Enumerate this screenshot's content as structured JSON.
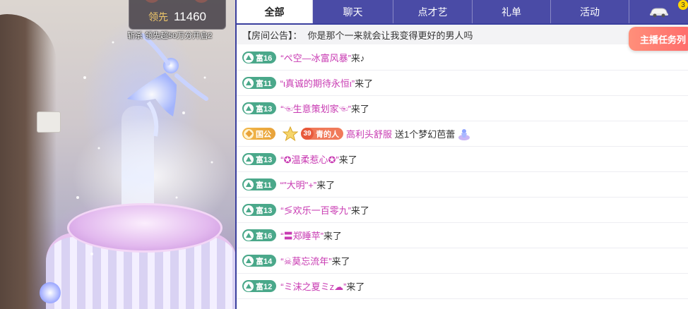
{
  "video": {
    "lead_label": "领先",
    "lead_value": "11460",
    "pk_tip": "斩杀  领先超50万分开启2"
  },
  "tabs": [
    {
      "label": "全部",
      "active": true
    },
    {
      "label": "聊天",
      "active": false
    },
    {
      "label": "点才艺",
      "active": false
    },
    {
      "label": "礼单",
      "active": false
    },
    {
      "label": "活动",
      "active": false
    },
    {
      "label": "",
      "icon": "car-icon",
      "badge": "3",
      "active": false
    }
  ],
  "notice": {
    "label": "【房间公告】：",
    "text": "你是那个一来就会让我变得更好的男人吗"
  },
  "task_button": "主播任务列",
  "messages": [
    {
      "type": "enter",
      "badge": "富16",
      "name": "“ぺ空—冰富风暴”",
      "suffix": "来♪"
    },
    {
      "type": "enter",
      "badge": "富11",
      "name": "“ι真诚的期待永恒ι”",
      "suffix": "来了"
    },
    {
      "type": "enter",
      "badge": "富13",
      "name": "“☜生意策划家☜”",
      "suffix": "来了"
    },
    {
      "type": "gift",
      "badge": "国公",
      "fan_level": "39",
      "fan_name": "青的人",
      "user": "高利头舒服",
      "text": "送1个梦幻芭蕾"
    },
    {
      "type": "enter",
      "badge": "富13",
      "name": "“✪温柔惹心✪”",
      "suffix": "来了"
    },
    {
      "type": "enter",
      "badge": "富11",
      "name": "“\"大明\"+”",
      "suffix": "来了"
    },
    {
      "type": "enter",
      "badge": "富13",
      "name": "“≶欢乐一百零九”",
      "suffix": "来了"
    },
    {
      "type": "enter",
      "badge": "富16",
      "name": "“〓郑睡苹”",
      "suffix": "来了"
    },
    {
      "type": "enter",
      "badge": "富14",
      "name": "“☠莫忘流年”",
      "suffix": "来了"
    },
    {
      "type": "enter",
      "badge": "富12",
      "name": "“ミ沫之夏ミz☁”",
      "suffix": "来了"
    }
  ],
  "colors": {
    "tab_bar": "#4a4ba6",
    "rich_badge": "#4aa88a",
    "username": "#c83ab2",
    "task_button": "#ff7a6e"
  }
}
